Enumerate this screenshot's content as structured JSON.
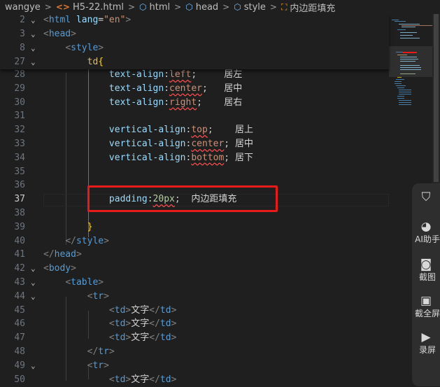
{
  "breadcrumb": [
    {
      "label": "wangye",
      "icon": ""
    },
    {
      "label": "H5-22.html",
      "icon": "html-file-icon",
      "glyph": "<>"
    },
    {
      "label": "html",
      "icon": "element-cube-icon",
      "glyph": "⬡"
    },
    {
      "label": "head",
      "icon": "element-cube-icon",
      "glyph": "⬡"
    },
    {
      "label": "style",
      "icon": "element-cube-icon",
      "glyph": "⬡"
    },
    {
      "label": "内边距填充",
      "icon": "symbol-icon",
      "glyph": "⛶"
    }
  ],
  "breadcrumb_separator": ">",
  "sticky_lines": [
    {
      "n": "2",
      "fold": "v",
      "tokens": [
        [
          "br",
          "<"
        ],
        [
          "tag",
          "html"
        ],
        [
          "txt",
          " "
        ],
        [
          "attr",
          "lang"
        ],
        [
          "txt",
          "="
        ],
        [
          "str",
          "\"en\""
        ],
        [
          "br",
          ">"
        ]
      ]
    },
    {
      "n": "3",
      "fold": "v",
      "tokens": [
        [
          "br",
          "<"
        ],
        [
          "tag",
          "head"
        ],
        [
          "br",
          ">"
        ]
      ]
    },
    {
      "n": "8",
      "fold": "v",
      "tokens": [
        [
          "txt",
          "    "
        ],
        [
          "br",
          "<"
        ],
        [
          "tag",
          "style"
        ],
        [
          "br",
          ">"
        ]
      ]
    },
    {
      "n": "27",
      "fold": "v",
      "tokens": [
        [
          "txt",
          "        "
        ],
        [
          "sel",
          "td"
        ],
        [
          "brace",
          "{"
        ]
      ]
    }
  ],
  "lines": [
    {
      "n": "28",
      "tokens": [
        [
          "txt",
          "            "
        ],
        [
          "prop",
          "text-align"
        ],
        [
          "pn",
          ":"
        ],
        [
          "val",
          "left"
        ],
        [
          "pn",
          ";"
        ],
        [
          "cmt",
          "     居左"
        ]
      ]
    },
    {
      "n": "29",
      "tokens": [
        [
          "txt",
          "            "
        ],
        [
          "prop",
          "text-align"
        ],
        [
          "pn",
          ":"
        ],
        [
          "val",
          "center"
        ],
        [
          "pn",
          ";"
        ],
        [
          "cmt",
          "   居中"
        ]
      ]
    },
    {
      "n": "30",
      "tokens": [
        [
          "txt",
          "            "
        ],
        [
          "prop",
          "text-align"
        ],
        [
          "pn",
          ":"
        ],
        [
          "val",
          "right"
        ],
        [
          "pn",
          ";"
        ],
        [
          "cmt",
          "    居右"
        ]
      ]
    },
    {
      "n": "31",
      "tokens": []
    },
    {
      "n": "32",
      "tokens": [
        [
          "txt",
          "            "
        ],
        [
          "prop",
          "vertical-align"
        ],
        [
          "pn",
          ":"
        ],
        [
          "val",
          "top"
        ],
        [
          "pn",
          ";"
        ],
        [
          "cmt",
          "    居上"
        ]
      ]
    },
    {
      "n": "33",
      "tokens": [
        [
          "txt",
          "            "
        ],
        [
          "prop",
          "vertical-align"
        ],
        [
          "pn",
          ":"
        ],
        [
          "val",
          "center"
        ],
        [
          "pn",
          ";"
        ],
        [
          "cmt",
          " 居中"
        ]
      ]
    },
    {
      "n": "34",
      "tokens": [
        [
          "txt",
          "            "
        ],
        [
          "prop",
          "vertical-align"
        ],
        [
          "pn",
          ":"
        ],
        [
          "val",
          "bottom"
        ],
        [
          "pn",
          ";"
        ],
        [
          "cmt",
          " 居下"
        ]
      ]
    },
    {
      "n": "35",
      "tokens": []
    },
    {
      "n": "36",
      "tokens": []
    },
    {
      "n": "37",
      "active": true,
      "tokens": [
        [
          "txt",
          "            "
        ],
        [
          "prop",
          "padding"
        ],
        [
          "pn",
          ":"
        ],
        [
          "num",
          "20px"
        ],
        [
          "pn",
          ";"
        ],
        [
          "cmt",
          "  内边距填充"
        ]
      ]
    },
    {
      "n": "38",
      "tokens": []
    },
    {
      "n": "39",
      "tokens": [
        [
          "txt",
          "        "
        ],
        [
          "brace",
          "}"
        ]
      ]
    },
    {
      "n": "40",
      "fold": "",
      "tokens": [
        [
          "txt",
          "    "
        ],
        [
          "br",
          "</"
        ],
        [
          "tag",
          "style"
        ],
        [
          "br",
          ">"
        ]
      ]
    },
    {
      "n": "41",
      "tokens": [
        [
          "br",
          "</"
        ],
        [
          "tag",
          "head"
        ],
        [
          "br",
          ">"
        ]
      ]
    },
    {
      "n": "42",
      "fold": "v",
      "tokens": [
        [
          "br",
          "<"
        ],
        [
          "tag",
          "body"
        ],
        [
          "br",
          ">"
        ]
      ]
    },
    {
      "n": "43",
      "fold": "v",
      "tokens": [
        [
          "txt",
          "    "
        ],
        [
          "br",
          "<"
        ],
        [
          "tag",
          "table"
        ],
        [
          "br",
          ">"
        ]
      ]
    },
    {
      "n": "44",
      "fold": "v",
      "tokens": [
        [
          "txt",
          "        "
        ],
        [
          "br",
          "<"
        ],
        [
          "tag",
          "tr"
        ],
        [
          "br",
          ">"
        ]
      ]
    },
    {
      "n": "45",
      "tokens": [
        [
          "txt",
          "            "
        ],
        [
          "br",
          "<"
        ],
        [
          "tag",
          "td"
        ],
        [
          "br",
          ">"
        ],
        [
          "txt",
          "文字"
        ],
        [
          "br",
          "</"
        ],
        [
          "tag",
          "td"
        ],
        [
          "br",
          ">"
        ]
      ]
    },
    {
      "n": "46",
      "tokens": [
        [
          "txt",
          "            "
        ],
        [
          "br",
          "<"
        ],
        [
          "tag",
          "td"
        ],
        [
          "br",
          ">"
        ],
        [
          "txt",
          "文字"
        ],
        [
          "br",
          "</"
        ],
        [
          "tag",
          "td"
        ],
        [
          "br",
          ">"
        ]
      ]
    },
    {
      "n": "47",
      "tokens": [
        [
          "txt",
          "            "
        ],
        [
          "br",
          "<"
        ],
        [
          "tag",
          "td"
        ],
        [
          "br",
          ">"
        ],
        [
          "txt",
          "文字"
        ],
        [
          "br",
          "</"
        ],
        [
          "tag",
          "td"
        ],
        [
          "br",
          ">"
        ]
      ]
    },
    {
      "n": "48",
      "tokens": [
        [
          "txt",
          "        "
        ],
        [
          "br",
          "</"
        ],
        [
          "tag",
          "tr"
        ],
        [
          "br",
          ">"
        ]
      ]
    },
    {
      "n": "49",
      "fold": "v",
      "tokens": [
        [
          "txt",
          "        "
        ],
        [
          "br",
          "<"
        ],
        [
          "tag",
          "tr"
        ],
        [
          "br",
          ">"
        ]
      ]
    },
    {
      "n": "50",
      "tokens": [
        [
          "txt",
          "            "
        ],
        [
          "br",
          "<"
        ],
        [
          "tag",
          "td"
        ],
        [
          "br",
          ">"
        ],
        [
          "txt",
          "文字"
        ],
        [
          "br",
          "</"
        ],
        [
          "tag",
          "td"
        ],
        [
          "br",
          ">"
        ]
      ]
    }
  ],
  "tools": [
    {
      "name": "shield-tool",
      "icon": "shield-icon",
      "glyph": "⛉",
      "label": ""
    },
    {
      "name": "ai-assistant-tool",
      "icon": "ai-assistant-icon",
      "glyph": "◕",
      "label": "AI助手"
    },
    {
      "name": "screenshot-tool",
      "icon": "camera-icon",
      "glyph": "◙",
      "label": "截图"
    },
    {
      "name": "fullscreen-capture-tool",
      "icon": "monitor-capture-icon",
      "glyph": "▣",
      "label": "截全屏"
    },
    {
      "name": "record-tool",
      "icon": "video-camera-icon",
      "glyph": "▶",
      "label": "录屏"
    }
  ],
  "colors": {
    "editor_bg": "#1f1f1f",
    "highlight_box": "#e81b1b",
    "tag": "#569cd6",
    "property": "#9cdcfe",
    "value": "#ce9178",
    "number": "#b5cea8",
    "selector": "#d7ba7d"
  }
}
